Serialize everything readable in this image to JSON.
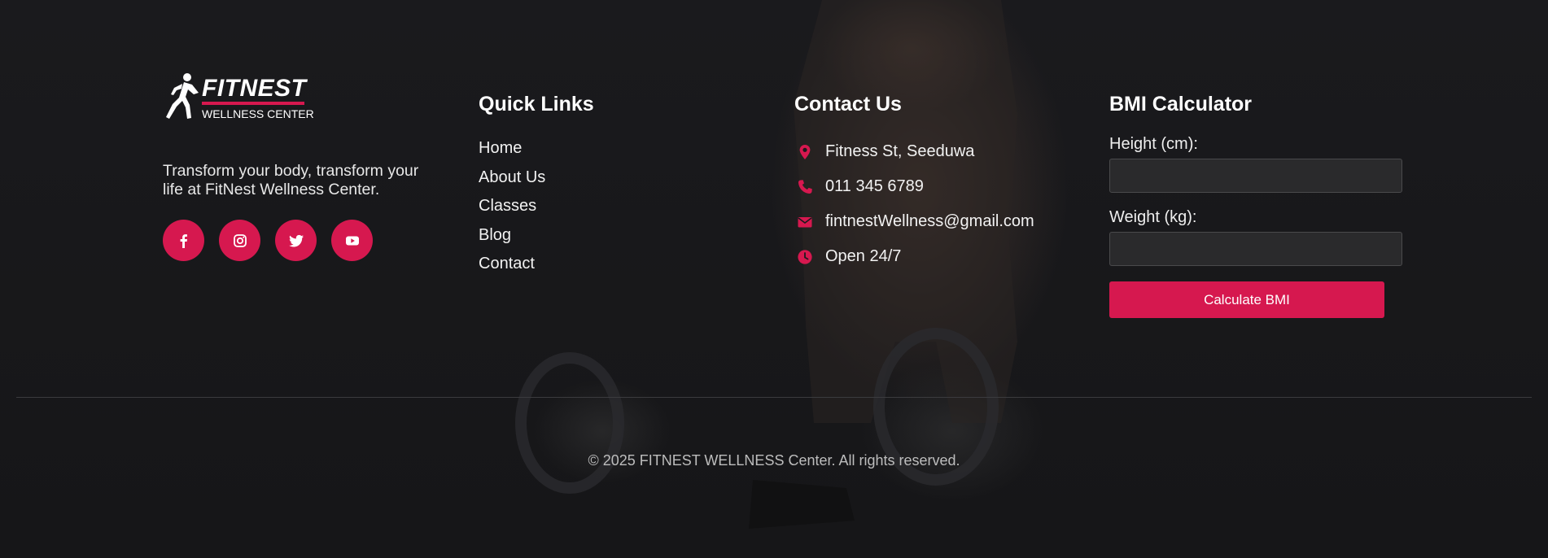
{
  "brand": {
    "logo_main": "FITNEST",
    "logo_sub": "WELLNESS CENTER",
    "tagline": "Transform your body, transform your life at FitNest Wellness Center.",
    "socials": [
      {
        "icon": "facebook-icon"
      },
      {
        "icon": "instagram-icon"
      },
      {
        "icon": "twitter-icon"
      },
      {
        "icon": "youtube-icon"
      }
    ]
  },
  "quick_links": {
    "title": "Quick Links",
    "items": [
      "Home",
      "About Us",
      "Classes",
      "Blog",
      "Contact"
    ]
  },
  "contact": {
    "title": "Contact Us",
    "items": [
      {
        "icon": "location-pin-icon",
        "text": "Fitness St, Seeduwa"
      },
      {
        "icon": "phone-icon",
        "text": "011 345 6789"
      },
      {
        "icon": "envelope-icon",
        "text": "fintnestWellness@gmail.com"
      },
      {
        "icon": "clock-icon",
        "text": "Open 24/7"
      }
    ]
  },
  "bmi": {
    "title": "BMI Calculator",
    "height_label": "Height (cm):",
    "height_value": "",
    "weight_label": "Weight (kg):",
    "weight_value": "",
    "button_label": "Calculate BMI"
  },
  "footer": {
    "copyright": "© 2025 FITNEST WELLNESS Center. All rights reserved."
  },
  "colors": {
    "accent": "#d6184f",
    "background": "#18181a",
    "text": "#e8e8e8"
  }
}
